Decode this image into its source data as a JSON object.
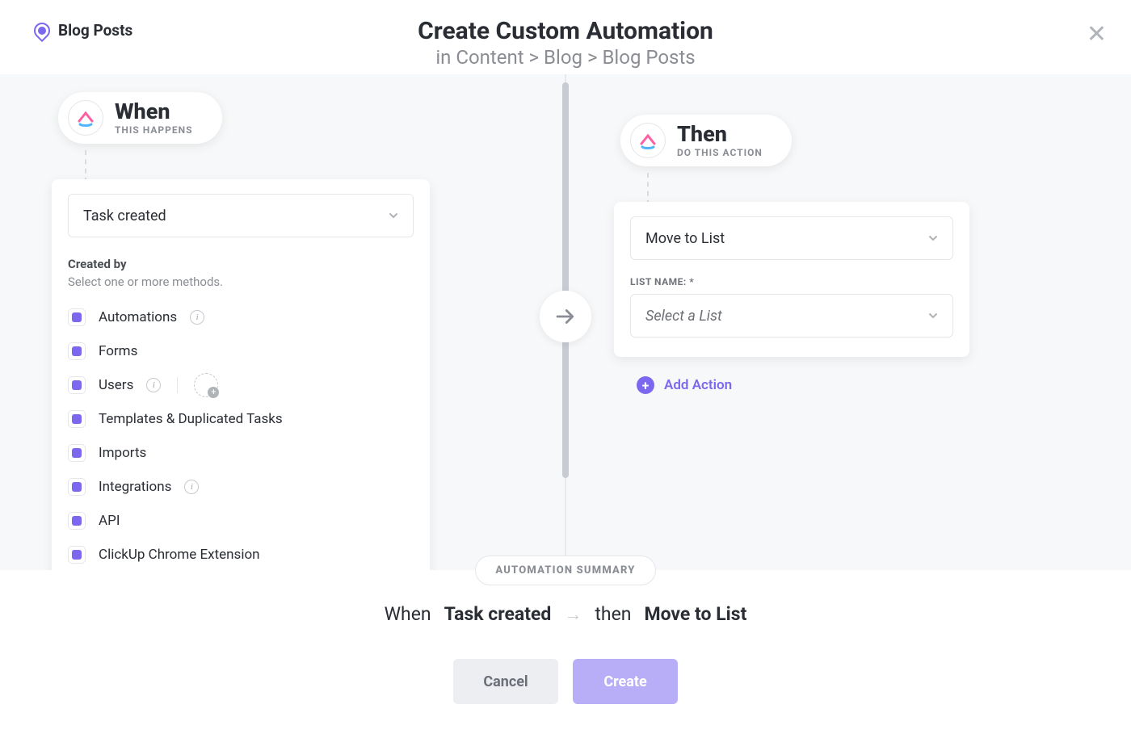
{
  "header": {
    "location": "Blog Posts",
    "title": "Create Custom Automation",
    "breadcrumb": "in Content > Blog > Blog Posts"
  },
  "when": {
    "pill_title": "When",
    "pill_subtitle": "THIS HAPPENS",
    "trigger_selected": "Task created",
    "created_by_label": "Created by",
    "created_by_hint": "Select one or more methods.",
    "options": [
      {
        "label": "Automations",
        "has_info": true
      },
      {
        "label": "Forms"
      },
      {
        "label": "Users",
        "has_info": true,
        "has_people": true
      },
      {
        "label": "Templates & Duplicated Tasks"
      },
      {
        "label": "Imports"
      },
      {
        "label": "Integrations",
        "has_info": true
      },
      {
        "label": "API"
      },
      {
        "label": "ClickUp Chrome Extension"
      }
    ]
  },
  "then": {
    "pill_title": "Then",
    "pill_subtitle": "DO THIS ACTION",
    "action_selected": "Move to List",
    "list_name_label": "LIST NAME: *",
    "list_placeholder": "Select a List",
    "add_action_label": "Add Action"
  },
  "footer": {
    "summary_label": "AUTOMATION SUMMARY",
    "summary_when_word": "When",
    "summary_trigger": "Task created",
    "summary_then_word": "then",
    "summary_action": "Move to List",
    "cancel": "Cancel",
    "create": "Create"
  }
}
